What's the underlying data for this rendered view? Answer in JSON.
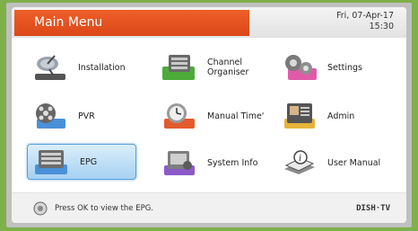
{
  "header": {
    "title": "Main Menu",
    "date": "Fri, 07-Apr-17",
    "time": "15:30"
  },
  "menu": {
    "installation": "Installation",
    "channel_organiser_line1": "Channel",
    "channel_organiser_line2": "Organiser",
    "settings": "Settings",
    "pvr": "PVR",
    "manual_timer": "Manual Time'",
    "admin": "Admin",
    "epg": "EPG",
    "system_info": "System Info",
    "user_manual": "User Manual",
    "selected": "EPG"
  },
  "footer": {
    "hint": "Press OK to view the EPG.",
    "brand": "DISH·TV"
  },
  "colors": {
    "header_accent": "#e2531f",
    "selected": "#a6d1f1",
    "outer_bezel": "#7fb04a"
  }
}
